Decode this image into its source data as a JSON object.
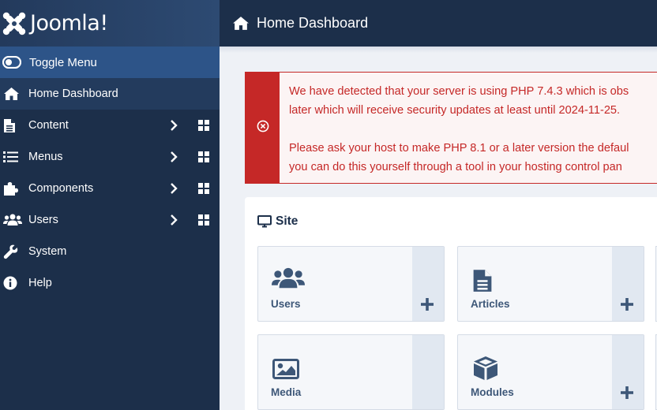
{
  "brand": {
    "name": "Joomla!",
    "logo_icon": "joomla-logo-icon"
  },
  "sidebar": {
    "toggle_label": "Toggle Menu",
    "items": [
      {
        "label": "Home Dashboard",
        "icon": "home-icon",
        "active": true
      },
      {
        "label": "Content",
        "icon": "file-icon",
        "has_children": true,
        "has_dashboard": true
      },
      {
        "label": "Menus",
        "icon": "list-icon",
        "has_children": true,
        "has_dashboard": true
      },
      {
        "label": "Components",
        "icon": "puzzle-icon",
        "has_children": true,
        "has_dashboard": true
      },
      {
        "label": "Users",
        "icon": "users-icon",
        "has_children": true,
        "has_dashboard": true
      },
      {
        "label": "System",
        "icon": "wrench-icon"
      },
      {
        "label": "Help",
        "icon": "info-icon"
      }
    ]
  },
  "header": {
    "title": "Home Dashboard",
    "icon": "home-icon"
  },
  "alert": {
    "line1": "We have detected that your server is using PHP 7.4.3 which is obs",
    "line2": "later which will receive security updates at least until 2024-11-25.",
    "line3": "Please ask your host to make PHP 8.1 or a later version the defaul",
    "line4": "you can do this yourself through a tool in your hosting control pan",
    "icon": "error-circle-icon"
  },
  "site": {
    "title": "Site",
    "icon": "monitor-icon",
    "tiles": [
      {
        "label": "Users",
        "icon": "users-icon"
      },
      {
        "label": "Articles",
        "icon": "file-icon"
      },
      {
        "label": "Media",
        "icon": "image-icon"
      },
      {
        "label": "Modules",
        "icon": "cube-icon"
      }
    ]
  },
  "colors": {
    "sidebar_bg": "#1c2f4a",
    "toggle_bg": "#2d5488",
    "alert_red": "#c52827",
    "tile_text": "#3d5778"
  }
}
